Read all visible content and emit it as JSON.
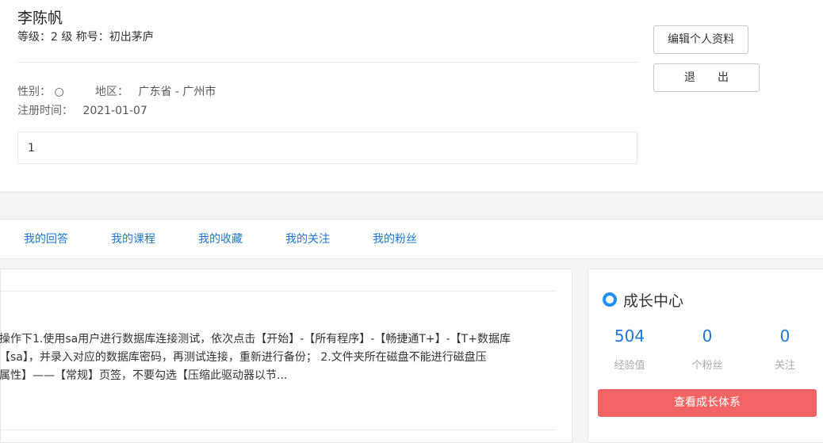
{
  "profile": {
    "name": "李陈帆",
    "level_text": "等级：2 级 称号：初出茅庐",
    "gender_label": "性别：",
    "gender_value": "○",
    "region_label": "地区：",
    "region_value": "广东省 - 广州市",
    "regtime_label": "注册时间：",
    "regtime_value": "2021-01-07",
    "bio": "1",
    "edit_button": "编辑个人资料",
    "logout_button": "退出"
  },
  "tabs": [
    {
      "label": "我的回答"
    },
    {
      "label": "我的课程"
    },
    {
      "label": "我的收藏"
    },
    {
      "label": "我的关注"
    },
    {
      "label": "我的粉丝"
    }
  ],
  "answer": {
    "lines": [
      "操作下1.使用sa用户进行数据库连接测试，依次点击【开始】-【所有程序】-【畅捷通T+】-【T+数据库",
      "【sa】，并录入对应的数据库密码，再测试连接，重新进行备份； 2.文件夹所在磁盘不能进行磁盘压",
      "属性】——【常规】页签，不要勾选【压缩此驱动器以节..."
    ]
  },
  "growth": {
    "title": "成长中心",
    "stats": [
      {
        "value": "504",
        "label": "经验值"
      },
      {
        "value": "0",
        "label": "个粉丝"
      },
      {
        "value": "0",
        "label": "关注"
      }
    ],
    "button": "查看成长体系",
    "accent_color": "#1e90ff",
    "button_color": "#f56464"
  }
}
